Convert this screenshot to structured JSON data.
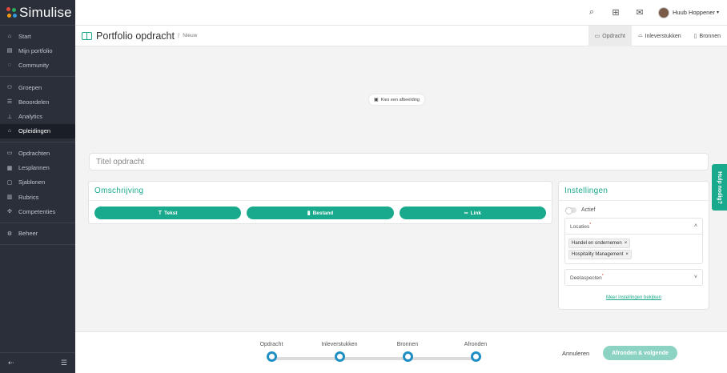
{
  "app": {
    "logo_text": "Simulise",
    "logo_colors": [
      "#e64a3c",
      "#27ae60",
      "#f39c12",
      "#3498db"
    ]
  },
  "sidebar": {
    "groups": [
      [
        {
          "label": "Start",
          "icon": "home-icon"
        },
        {
          "label": "Mijn portfolio",
          "icon": "briefcase-icon"
        },
        {
          "label": "Community",
          "icon": "chat-icon"
        }
      ],
      [
        {
          "label": "Groepen",
          "icon": "users-icon"
        },
        {
          "label": "Beoordelen",
          "icon": "list-check-icon"
        },
        {
          "label": "Analytics",
          "icon": "chart-icon"
        },
        {
          "label": "Opleidingen",
          "icon": "school-icon",
          "active": true
        }
      ],
      [
        {
          "label": "Opdrachten",
          "icon": "book-icon"
        },
        {
          "label": "Lesplannen",
          "icon": "calendar-icon"
        },
        {
          "label": "Sjablonen",
          "icon": "template-icon"
        },
        {
          "label": "Rubrics",
          "icon": "grid-icon"
        },
        {
          "label": "Competenties",
          "icon": "competence-icon"
        }
      ],
      [
        {
          "label": "Beheer",
          "icon": "settings-icon"
        }
      ]
    ]
  },
  "topbar": {
    "user_name": "Huub Hoppener"
  },
  "page": {
    "title": "Portfolio opdracht",
    "separator": "/",
    "breadcrumb": "Nieuw",
    "tabs": [
      {
        "label": "Opdracht",
        "icon": "book-icon",
        "active": true
      },
      {
        "label": "Inleverstukken",
        "icon": "inbox-icon"
      },
      {
        "label": "Bronnen",
        "icon": "file-icon"
      }
    ]
  },
  "cover": {
    "choose_image_label": "Kies een afbeelding"
  },
  "title_input": {
    "placeholder": "Titel opdracht"
  },
  "description": {
    "title": "Omschrijving",
    "buttons": [
      {
        "label": "Tekst",
        "icon": "text-icon"
      },
      {
        "label": "Bestand",
        "icon": "file-icon"
      },
      {
        "label": "Link",
        "icon": "link-icon"
      }
    ]
  },
  "settings": {
    "title": "Instellingen",
    "active_label": "Actief",
    "active_value": false,
    "locations_label": "Locaties",
    "locations": [
      "Handel en ondernemen",
      "Hospitality Management"
    ],
    "sub_aspects_label": "Deelaspecten",
    "required_mark": "*",
    "more_link": "Meer instellingen bekijken"
  },
  "help": {
    "label": "Hulp nodig?"
  },
  "footer": {
    "steps": [
      "Opdracht",
      "Inleverstukken",
      "Bronnen",
      "Afronden"
    ],
    "cancel_label": "Annuleren",
    "finish_label": "Afronden & volgende"
  },
  "colors": {
    "accent": "#19a98c",
    "step_dot": "#1f8fc3",
    "sidebar_bg": "#2a2f3a"
  }
}
